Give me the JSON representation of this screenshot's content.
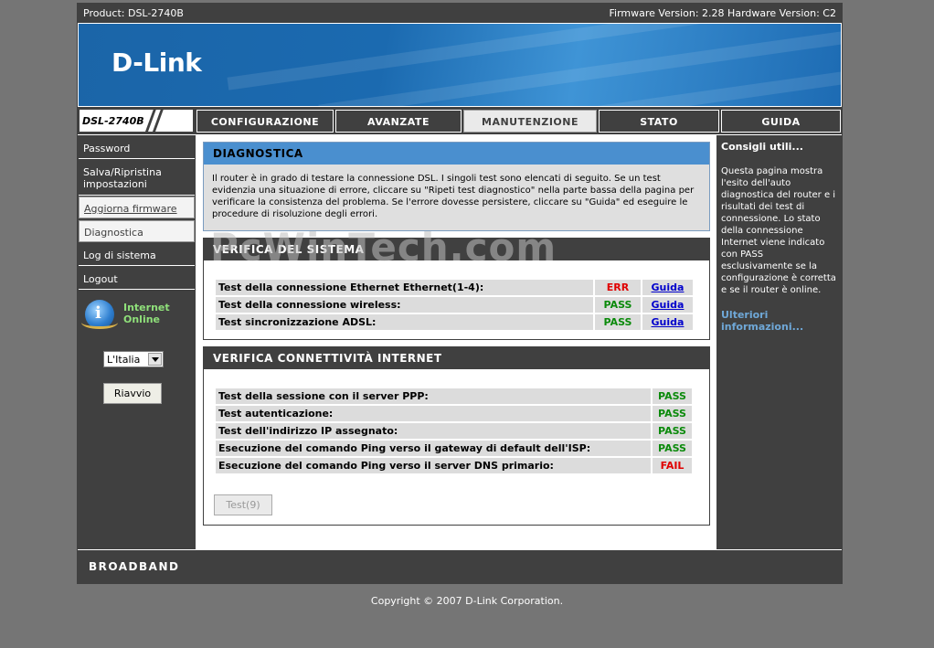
{
  "header": {
    "product": "Product: DSL-2740B",
    "firmware": "Firmware Version: 2.28 Hardware Version: C2",
    "logo": "D-Link",
    "model": "DSL-2740B"
  },
  "nav": {
    "tabs": [
      {
        "label": "CONFIGURAZIONE",
        "active": false
      },
      {
        "label": "AVANZATE",
        "active": false
      },
      {
        "label": "MANUTENZIONE",
        "active": true
      },
      {
        "label": "STATO",
        "active": false
      },
      {
        "label": "GUIDA",
        "active": false
      }
    ]
  },
  "sidebar": {
    "items": [
      {
        "label": "Password"
      },
      {
        "label": "Salva/Ripristina impostazioni"
      },
      {
        "label": "Aggiorna firmware"
      },
      {
        "label": "Diagnostica"
      },
      {
        "label": "Log di sistema"
      },
      {
        "label": "Logout"
      }
    ],
    "internet_status": "Internet Online",
    "language": "L'Italia",
    "reboot_label": "Riavvio"
  },
  "diag": {
    "title": "DIAGNOSTICA",
    "text": "Il router è in grado di testare la connessione DSL. I singoli test sono elencati di seguito. Se un test evidenzia una situazione di errore, cliccare su \"Ripeti test diagnostico\" nella parte bassa della pagina per verificare la consistenza del problema. Se l'errore dovesse persistere, cliccare su \"Guida\" ed eseguire le procedure di risoluzione degli errori."
  },
  "system": {
    "title": "VERIFICA DEL SISTEMA",
    "rows": [
      {
        "name": "Test della connessione Ethernet Ethernet(1-4):",
        "result": "ERR",
        "link": "Guida"
      },
      {
        "name": "Test della connessione wireless:",
        "result": "PASS",
        "link": "Guida"
      },
      {
        "name": "Test sincronizzazione ADSL:",
        "result": "PASS",
        "link": "Guida"
      }
    ]
  },
  "internet": {
    "title": "VERIFICA CONNETTIVITÀ INTERNET",
    "rows": [
      {
        "name": "Test della sessione con il server PPP:",
        "result": "PASS"
      },
      {
        "name": "Test autenticazione:",
        "result": "PASS"
      },
      {
        "name": "Test dell'indirizzo IP assegnato:",
        "result": "PASS"
      },
      {
        "name": "Esecuzione del comando Ping verso il gateway di default dell'ISP:",
        "result": "PASS"
      },
      {
        "name": "Esecuzione del comando Ping verso il server DNS primario:",
        "result": "FAIL"
      }
    ],
    "test_button": "Test(9)"
  },
  "help": {
    "title": "Consigli utili...",
    "text": "Questa pagina mostra l'esito dell'auto diagnostica del router e i risultati dei test di connessione. Lo stato della connessione Internet viene indicato con PASS esclusivamente se la configurazione è corretta e se il router è online.",
    "more": "Ulteriori informazioni..."
  },
  "footer": {
    "brand": "BROADBAND",
    "copyright": "Copyright © 2007 D-Link Corporation."
  },
  "watermark": "PcWinTech.com"
}
